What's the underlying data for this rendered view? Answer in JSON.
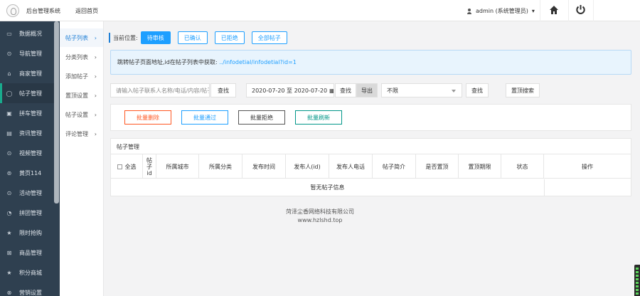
{
  "header": {
    "brand": "后台管理系统",
    "back_home": "返回首页",
    "admin": "admin (系统管理员)",
    "admin_caret": "▾"
  },
  "sidebar": {
    "items": [
      {
        "label": "数据概况",
        "icon": "monitor-icon",
        "glyph": "▭"
      },
      {
        "label": "导航管理",
        "icon": "compass-icon",
        "glyph": "⊙"
      },
      {
        "label": "商家管理",
        "icon": "bank-icon",
        "glyph": "⌂"
      },
      {
        "label": "帖子管理",
        "icon": "comment-icon",
        "glyph": "◯"
      },
      {
        "label": "拼车管理",
        "icon": "car-icon",
        "glyph": "▣"
      },
      {
        "label": "资讯管理",
        "icon": "book-icon",
        "glyph": "▤"
      },
      {
        "label": "视频管理",
        "icon": "video-icon",
        "glyph": "⊙"
      },
      {
        "label": "黄页114",
        "icon": "phone-circle-icon",
        "glyph": "⊚"
      },
      {
        "label": "活动管理",
        "icon": "gear-icon",
        "glyph": "⊙"
      },
      {
        "label": "拼团管理",
        "icon": "headset-icon",
        "glyph": "◔"
      },
      {
        "label": "限时抢购",
        "icon": "star-icon",
        "glyph": "★"
      },
      {
        "label": "商品管理",
        "icon": "cart-icon",
        "glyph": "⊠"
      },
      {
        "label": "积分商城",
        "icon": "star-icon",
        "glyph": "★"
      },
      {
        "label": "营销设置",
        "icon": "settings-icon",
        "glyph": "⊗"
      }
    ]
  },
  "submenu": {
    "items": [
      {
        "label": "帖子列表",
        "arrow": "›"
      },
      {
        "label": "分类列表",
        "arrow": "›"
      },
      {
        "label": "添加帖子",
        "arrow": "›"
      },
      {
        "label": "置顶设置",
        "arrow": "›"
      },
      {
        "label": "帖子设置",
        "arrow": "›"
      },
      {
        "label": "评论管理",
        "arrow": "›"
      }
    ]
  },
  "crumb": {
    "label": "当前位置:",
    "tabs": [
      "待审核",
      "已确认",
      "已拒绝",
      "全部帖子"
    ]
  },
  "notice": {
    "text": "跳转帖子页面地址,id在帖子列表中获取: ",
    "link": "../infodetial/infodetial?id=1"
  },
  "search": {
    "keyword_placeholder": "请输入帖子联系人名称/电话/内容/帖子id",
    "search_btn": "查找",
    "date_range": "2020-07-20 至 2020-07-20",
    "date_icon": "▦",
    "search_btn2": "查找",
    "export_btn": "导出",
    "select_value": "不限",
    "search_btn3": "查找",
    "reset_btn": "置顶搜索"
  },
  "batch": {
    "delete": "批量删除",
    "approve": "批量通过",
    "reject": "批量拒绝",
    "refresh": "批量刷新"
  },
  "table": {
    "title": "帖子管理",
    "select_all": "全选",
    "id_header": "帖子id",
    "columns": [
      "所属城市",
      "所属分类",
      "发布时间",
      "发布人(id)",
      "发布人电话",
      "帖子简介",
      "是否置顶",
      "置顶期限",
      "状态",
      "操作"
    ],
    "empty": "暂无帖子信息"
  },
  "footer": {
    "company": "菏泽尘香网络科技有限公司",
    "site": "www.hzlshd.top"
  },
  "colors": {
    "sidebar_bg": "#2f4050",
    "primary": "#1e9fff",
    "delete": "#ff5722",
    "refresh": "#009688"
  }
}
